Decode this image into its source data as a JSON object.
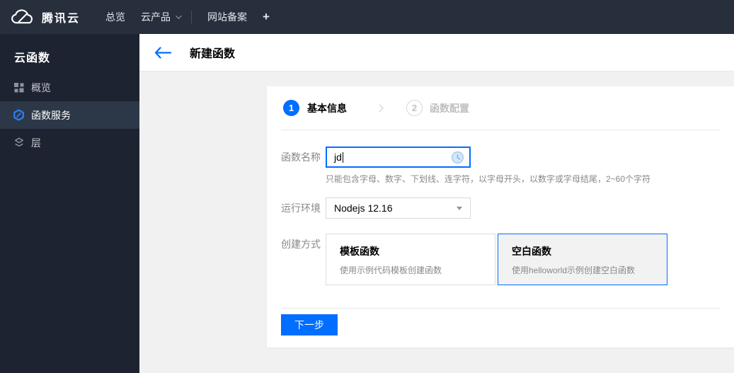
{
  "colors": {
    "accent": "#006eff",
    "topbar_bg": "#272e3c",
    "sidebar_bg": "#1d2330",
    "sidebar_active_bg": "#2c3747",
    "content_bg": "#f1f1f2"
  },
  "icons": {
    "logo": "tencent-cloud-logo",
    "products_caret": "chevron-down-icon",
    "overview": "grid-icon",
    "service": "scf-hexagon-icon",
    "layers": "layers-icon",
    "back": "back-arrow-icon",
    "name_status": "clock-icon",
    "select_caret": "caret-down-icon"
  },
  "topbar": {
    "brand": "腾讯云",
    "overview": "总览",
    "products": "云产品",
    "icp": "网站备案",
    "add": "+"
  },
  "sidebar": {
    "title": "云函数",
    "items": [
      {
        "label": "概览",
        "active": false
      },
      {
        "label": "函数服务",
        "active": true
      },
      {
        "label": "层",
        "active": false
      }
    ]
  },
  "header": {
    "title": "新建函数"
  },
  "wizard": {
    "step1_num": "1",
    "step1_label": "基本信息",
    "step2_num": "2",
    "step2_label": "函数配置"
  },
  "form": {
    "name_label": "函数名称",
    "name_value": "jd",
    "name_hint": "只能包含字母、数字、下划线、连字符，以字母开头，以数字或字母结尾，2~60个字符",
    "runtime_label": "运行环境",
    "runtime_value": "Nodejs 12.16",
    "method_label": "创建方式",
    "cards": [
      {
        "title": "模板函数",
        "desc": "使用示例代码模板创建函数",
        "selected": false
      },
      {
        "title": "空白函数",
        "desc": "使用helloworld示例创建空白函数",
        "selected": true
      }
    ]
  },
  "footer": {
    "next": "下一步"
  }
}
